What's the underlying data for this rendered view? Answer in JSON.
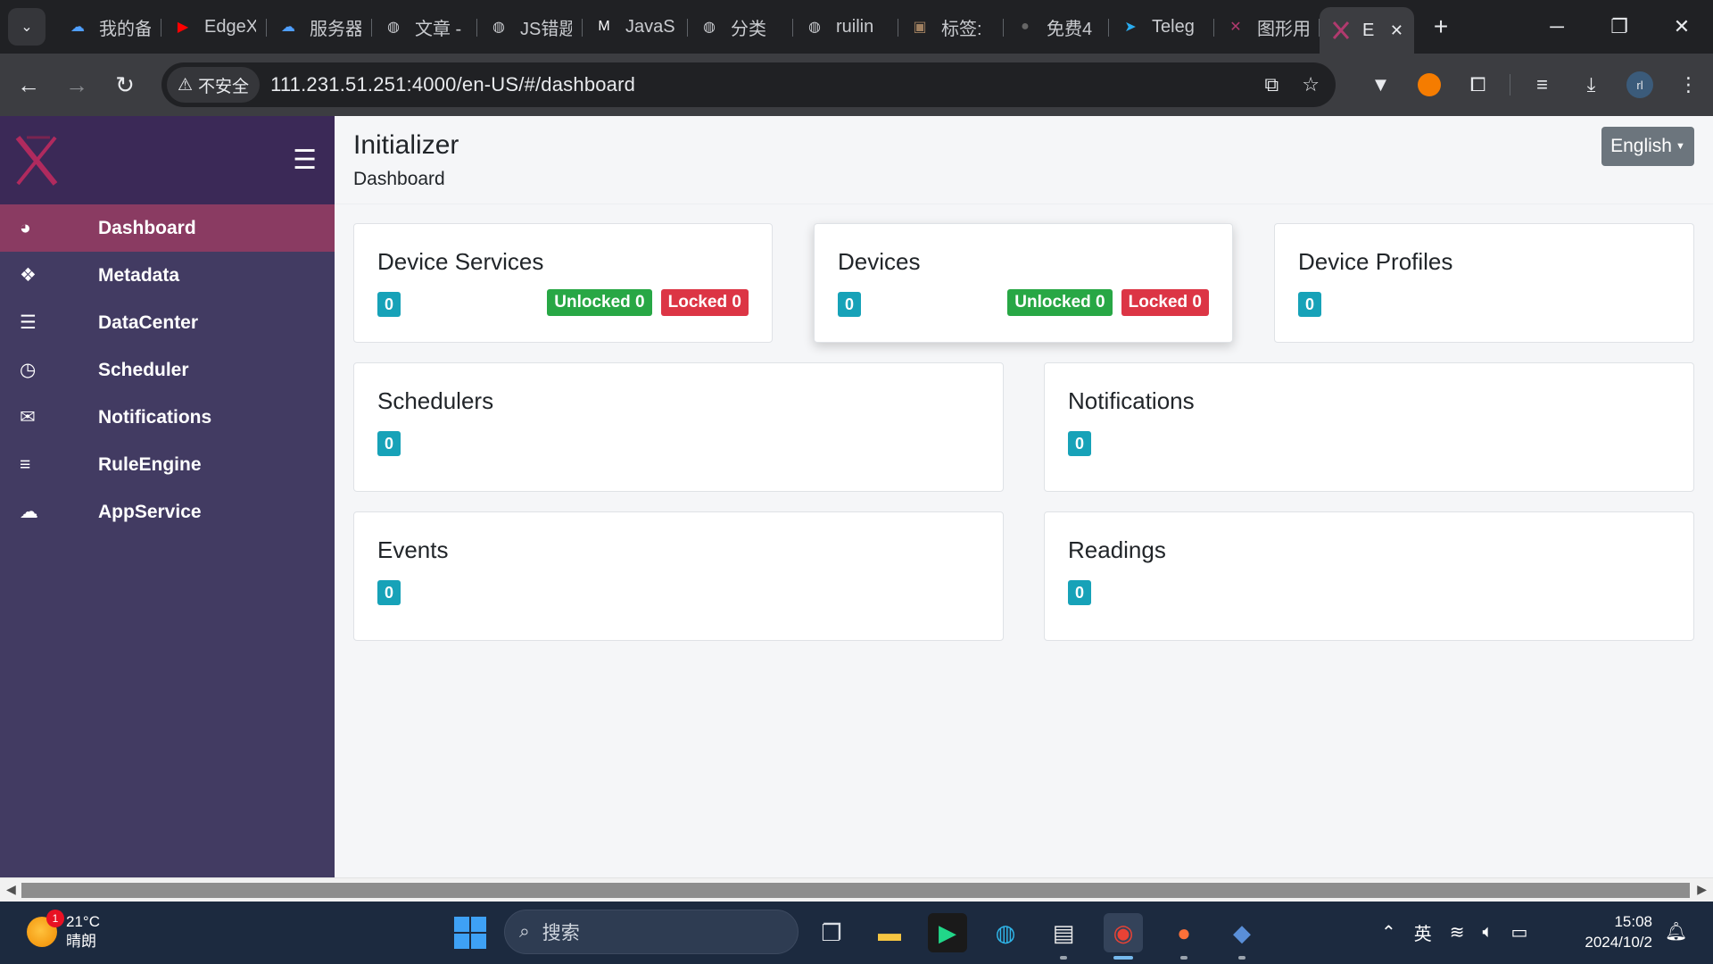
{
  "browser": {
    "tabs": [
      {
        "title": "我的备",
        "icon": "cloud-icon",
        "color": "#4f9fff"
      },
      {
        "title": "EdgeX",
        "icon": "youtube-icon",
        "color": "#ff0000"
      },
      {
        "title": "服务器",
        "icon": "cloud-icon",
        "color": "#4f9fff"
      },
      {
        "title": "文章 -",
        "icon": "globe-icon",
        "color": "#c9cbcf"
      },
      {
        "title": "JS错题",
        "icon": "globe-icon",
        "color": "#c9cbcf"
      },
      {
        "title": "JavaS",
        "icon": "m-icon",
        "color": "#ffffff"
      },
      {
        "title": "分类",
        "icon": "globe-icon",
        "color": "#c9cbcf"
      },
      {
        "title": "ruilin",
        "icon": "globe-icon",
        "color": "#c9cbcf"
      },
      {
        "title": "标签:",
        "icon": "image-icon",
        "color": "#a08060"
      },
      {
        "title": "免费4",
        "icon": "circles-icon",
        "color": "#666666"
      },
      {
        "title": "Teleg",
        "icon": "telegram-icon",
        "color": "#2aabee"
      },
      {
        "title": "图形用",
        "icon": "x-logo-icon",
        "color": "#b03a6e"
      }
    ],
    "active_tab": {
      "title": "E",
      "icon": "x-logo-icon"
    },
    "security_label": "不安全",
    "url": "111.231.51.251:4000/en-US/#/dashboard",
    "profile_initials": "rl"
  },
  "app": {
    "title": "Initializer",
    "breadcrumb": "Dashboard",
    "language": "English",
    "accent_color": "#8a3b62",
    "sidebar_color": "#423b62"
  },
  "sidebar": {
    "items": [
      {
        "label": "Dashboard",
        "icon": "dashboard-gauge-icon",
        "active": true
      },
      {
        "label": "Metadata",
        "icon": "cubes-icon",
        "active": false
      },
      {
        "label": "DataCenter",
        "icon": "database-icon",
        "active": false
      },
      {
        "label": "Scheduler",
        "icon": "clock-icon",
        "active": false
      },
      {
        "label": "Notifications",
        "icon": "envelope-icon",
        "active": false
      },
      {
        "label": "RuleEngine",
        "icon": "sliders-icon",
        "active": false
      },
      {
        "label": "AppService",
        "icon": "cloud-upload-icon",
        "active": false
      }
    ]
  },
  "cards": {
    "device_services": {
      "title": "Device Services",
      "count": "0",
      "unlocked": "Unlocked 0",
      "locked": "Locked 0"
    },
    "devices": {
      "title": "Devices",
      "count": "0",
      "unlocked": "Unlocked 0",
      "locked": "Locked 0"
    },
    "device_profiles": {
      "title": "Device Profiles",
      "count": "0"
    },
    "schedulers": {
      "title": "Schedulers",
      "count": "0"
    },
    "notifications": {
      "title": "Notifications",
      "count": "0"
    },
    "events": {
      "title": "Events",
      "count": "0"
    },
    "readings": {
      "title": "Readings",
      "count": "0"
    }
  },
  "taskbar": {
    "weather_temp": "21°C",
    "weather_desc": "晴朗",
    "weather_badge": "1",
    "search_placeholder": "搜索",
    "ime": "英",
    "time": "15:08",
    "date": "2024/10/2"
  }
}
